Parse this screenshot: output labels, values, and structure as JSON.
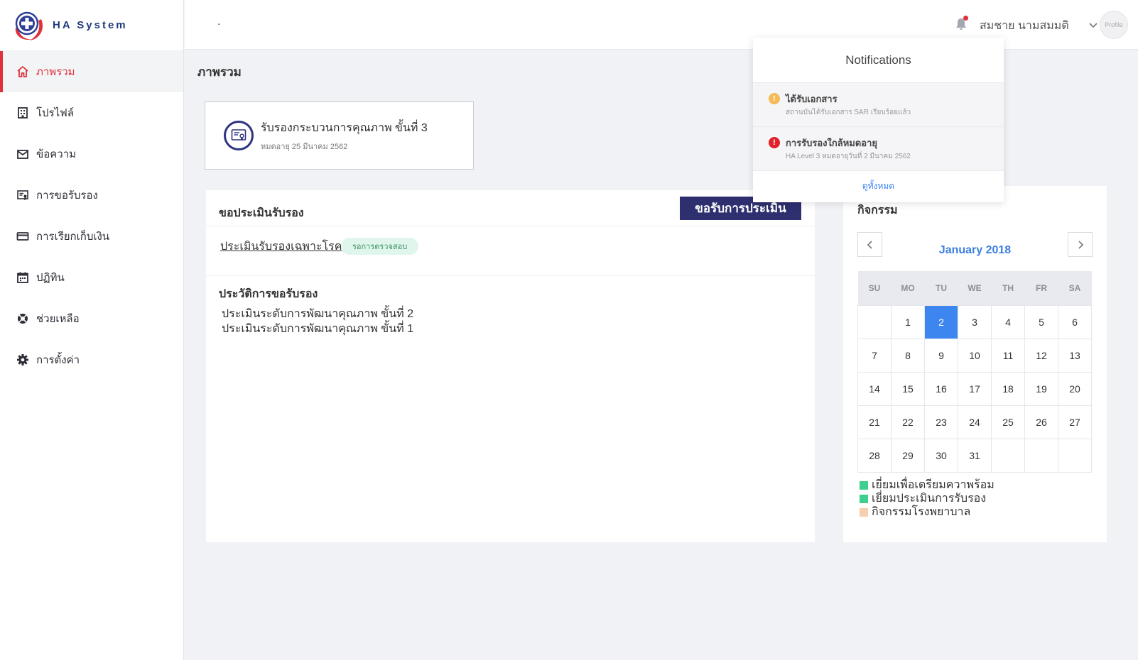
{
  "app": {
    "name": "HA System"
  },
  "sidebar": {
    "items": [
      {
        "label": "ภาพรวม",
        "icon": "home-icon",
        "active": true
      },
      {
        "label": "โปรไฟล์",
        "icon": "building-icon"
      },
      {
        "label": "ข้อความ",
        "icon": "mail-icon"
      },
      {
        "label": "การขอรับรอง",
        "icon": "certificate-icon"
      },
      {
        "label": "การเรียกเก็บเงิน",
        "icon": "credit-card-icon"
      },
      {
        "label": "ปฏิทิน",
        "icon": "calendar-icon"
      },
      {
        "label": "ช่วยเหลือ",
        "icon": "lifebuoy-icon"
      },
      {
        "label": "การตั้งค่า",
        "icon": "gear-icon"
      }
    ]
  },
  "header": {
    "search_placeholder": ".",
    "user_name": "สมชาย นามสมมติ",
    "avatar_label": "Profile"
  },
  "page": {
    "title": "ภาพรวม"
  },
  "accreditation": {
    "title": "รับรองกระบวนการคุณภาพ ขั้นที่ 3",
    "expiry": "หมดอายุ 25 มีนาคม 2562"
  },
  "assessment": {
    "title": "ขอประเมินรับรอง",
    "request_button": "ขอรับการประเมิน",
    "current_item": "ประเมินรับรองเฉพาะโรค",
    "status": "รอการตรวจสอบ",
    "history_title": "ประวัติการขอรับรอง",
    "history": [
      "ประเมินระดับการพัฒนาคุณภาพ ขั้นที่ 2",
      "ประเมินระดับการพัฒนาคุณภาพ ขั้นที่ 1"
    ]
  },
  "activities": {
    "title": "กิจกรรม",
    "month": "January 2018",
    "weekdays": [
      "SU",
      "MO",
      "TU",
      "WE",
      "TH",
      "FR",
      "SA"
    ],
    "weeks": [
      [
        "",
        "1",
        "2",
        "3",
        "4",
        "5",
        "6"
      ],
      [
        "7",
        "8",
        "9",
        "10",
        "11",
        "12",
        "13"
      ],
      [
        "14",
        "15",
        "16",
        "17",
        "18",
        "19",
        "20"
      ],
      [
        "21",
        "22",
        "23",
        "24",
        "25",
        "26",
        "27"
      ],
      [
        "28",
        "29",
        "30",
        "31",
        "",
        "",
        ""
      ]
    ],
    "selected_day": "2",
    "legend": [
      {
        "label": "เยี่ยมเพื่อเตรียมควาพร้อม",
        "color": "#3ecf8e"
      },
      {
        "label": "เยี่ยมประเมินการรับรอง",
        "color": "#3ecf8e"
      },
      {
        "label": "กิจกรรมโรงพยาบาล",
        "color": "#f7cfae"
      }
    ]
  },
  "notifications": {
    "title": "Notifications",
    "items": [
      {
        "title": "ได้รับเอกสาร",
        "detail": "สถานบันได้รับเอกสาร SAR เรียบร้อยแล้ว",
        "icon": "warning-icon",
        "color": "#f5b955"
      },
      {
        "title": "การรับรองใกล้หมดอายุ",
        "detail": "HA Level 3 หมดอายุวันที่ 2 มีนาคม 2562",
        "icon": "alert-icon",
        "color": "#e0202a"
      }
    ],
    "view_all": "ดูทั้งหมด"
  },
  "colors": {
    "accent_red": "#e0313b",
    "primary_navy": "#2e2f6e",
    "link_blue": "#3d85ef"
  }
}
